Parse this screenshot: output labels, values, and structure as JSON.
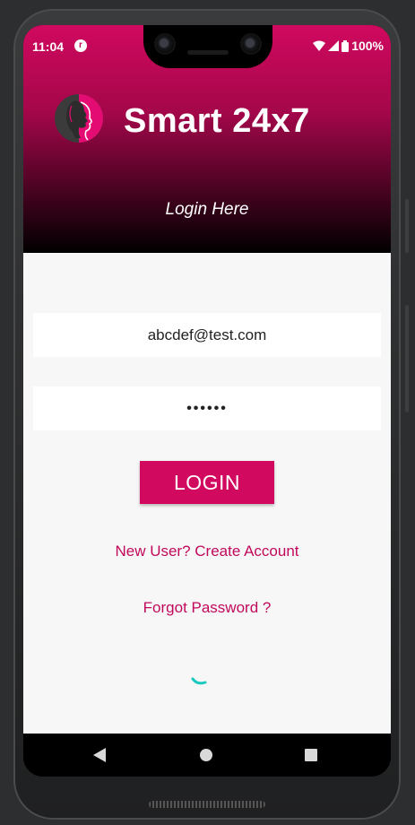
{
  "status_bar": {
    "time": "11:04",
    "app_icon_glyph": "r",
    "battery": "100%",
    "icons": [
      "wifi-icon",
      "signal-icon",
      "battery-icon"
    ]
  },
  "header": {
    "app_title": "Smart 24x7",
    "subtitle": "Login  Here",
    "logo_icon": "woman-profile-logo-icon"
  },
  "form": {
    "email_value": "abcdef@test.com",
    "password_value": "••••••",
    "login_label": "LOGIN"
  },
  "links": {
    "new_user": "New User?  Create Account",
    "forgot_password": "Forgot Password ?"
  },
  "loading": {
    "icon": "spinner-icon"
  },
  "nav_bar": {
    "icons": [
      "back-icon",
      "home-icon",
      "recents-icon"
    ]
  },
  "colors": {
    "brand": "#d1095f",
    "link": "#c1095c",
    "spinner": "#19c9c0",
    "background": "#f7f7f7"
  }
}
